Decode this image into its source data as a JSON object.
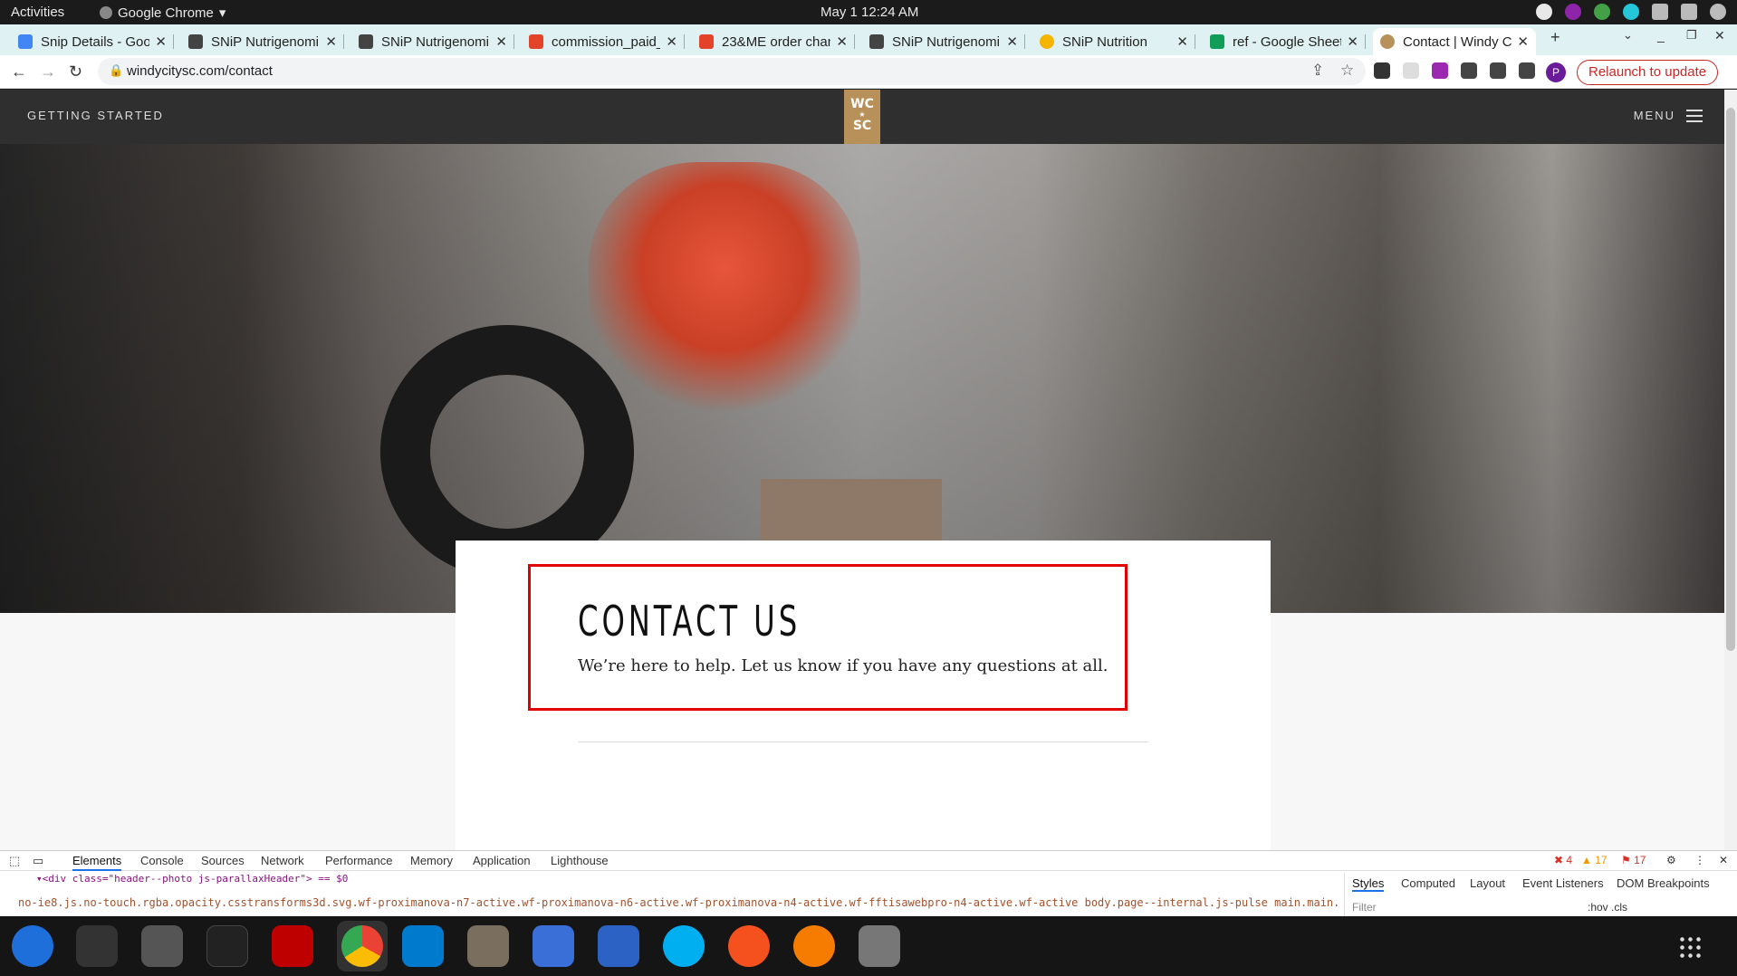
{
  "os": {
    "activities": "Activities",
    "app_name": "Google Chrome",
    "clock": "May 1  12:24 AM"
  },
  "tabs": [
    {
      "label": "Snip Details - Goo",
      "color": "#4285f4"
    },
    {
      "label": "SNiP Nutrigenomi",
      "color": "#444444"
    },
    {
      "label": "SNiP Nutrigenomi",
      "color": "#444444"
    },
    {
      "label": "commission_paid_",
      "color": "#e24329"
    },
    {
      "label": "23&ME order chan",
      "color": "#e24329"
    },
    {
      "label": "SNiP Nutrigenomi",
      "color": "#444444"
    },
    {
      "label": "SNiP Nutrition",
      "color": "#f4b400"
    },
    {
      "label": "ref - Google Sheet",
      "color": "#0f9d58"
    },
    {
      "label": "Contact | Windy Ci",
      "color": "#b8915a",
      "active": true
    }
  ],
  "toolbar": {
    "url": "windycitysc.com/contact",
    "profile_initial": "P",
    "relaunch_label": "Relaunch to update"
  },
  "site": {
    "nav_left": "GETTING STARTED",
    "logo_line1": "WC",
    "logo_line2": "SC",
    "menu_label": "MENU",
    "heading": "CONTACT US",
    "intro": "We’re here to help. Let us know if you have any questions at all."
  },
  "devtools": {
    "tabs": [
      "Elements",
      "Console",
      "Sources",
      "Network",
      "Performance",
      "Memory",
      "Application",
      "Lighthouse"
    ],
    "error_count": "4",
    "warning_count": "17",
    "issue_count": "17",
    "dom_line": "▾<div class=\"header--photo js-parallaxHeader\"> == $0",
    "crumbs": "no-ie8.js.no-touch.rgba.opacity.csstransforms3d.svg.wf-proximanova-n7-active.wf-proximanova-n6-active.wf-proximanova-n4-active.wf-fftisawebpro-n4-active.wf-active    body.page--internal.js-pulse    main.main.js-closeToggle    div.header--photo.js-parallaxHeader",
    "side_tabs": [
      "Styles",
      "Computed",
      "Layout",
      "Event Listeners",
      "DOM Breakpoints"
    ],
    "filter_placeholder": "Filter",
    "hov_cls": ":hov  .cls"
  },
  "dock": [
    {
      "name": "thunderbird-icon",
      "color": "#1e6fd9"
    },
    {
      "name": "terminal-icon",
      "color": "#333333"
    },
    {
      "name": "calculator-icon",
      "color": "#555555"
    },
    {
      "name": "system-monitor-icon",
      "color": "#222222"
    },
    {
      "name": "filezilla-icon",
      "color": "#bf0000"
    },
    {
      "name": "chrome-icon",
      "color": "#34a853",
      "active": true
    },
    {
      "name": "vscode-icon",
      "color": "#007acc"
    },
    {
      "name": "files-icon",
      "color": "#7a6e5e"
    },
    {
      "name": "text-editor-icon",
      "color": "#3b6fd8"
    },
    {
      "name": "document-viewer-icon",
      "color": "#2b62c4"
    },
    {
      "name": "skype-icon",
      "color": "#00aff0"
    },
    {
      "name": "inkscape-icon",
      "color": "#f4511e"
    },
    {
      "name": "blender-icon",
      "color": "#f57c00"
    },
    {
      "name": "disk-icon",
      "color": "#777777"
    }
  ]
}
